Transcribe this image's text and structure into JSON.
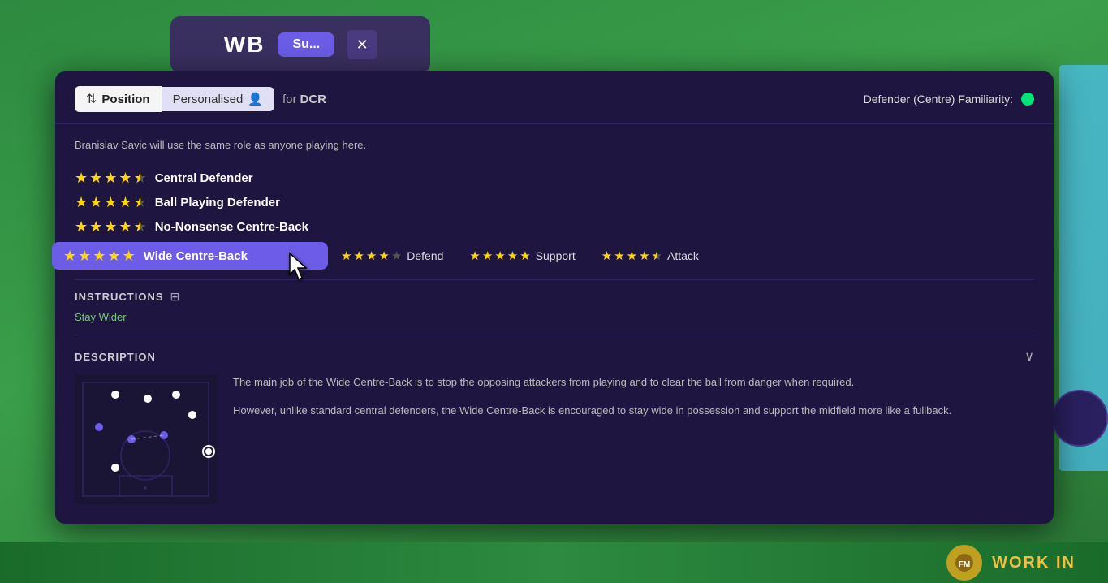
{
  "background": {
    "color": "#2d7a3a"
  },
  "modal": {
    "header": {
      "position_tab_label": "Position",
      "position_icon": "⇅",
      "personalised_label": "Personalised",
      "person_icon": "👤",
      "for_label": "for",
      "dcr_label": "DCR",
      "familiarity_label": "Defender (Centre) Familiarity:",
      "familiarity_color": "#00e676"
    },
    "subtitle": "Branislav Savic will use the same role as anyone playing here.",
    "roles": [
      {
        "name": "Central Defender",
        "stars": 4.5,
        "selected": false
      },
      {
        "name": "Ball Playing Defender",
        "stars": 4.5,
        "selected": false
      },
      {
        "name": "No-Nonsense Centre-Back",
        "stars": 4.5,
        "selected": false
      },
      {
        "name": "Wide Centre-Back",
        "stars": 5,
        "selected": true,
        "duties": [
          {
            "label": "Defend",
            "stars": 4
          },
          {
            "label": "Support",
            "stars": 5
          },
          {
            "label": "Attack",
            "stars": 4.5
          }
        ]
      }
    ],
    "instructions": {
      "title": "INSTRUCTIONS",
      "tags": [
        "Stay Wider"
      ]
    },
    "description": {
      "title": "DESCRIPTION",
      "paragraphs": [
        "The main job of the Wide Centre-Back is to stop the opposing attackers from playing and to clear the ball from danger when required.",
        "However, unlike standard central defenders, the Wide Centre-Back is encouraged to stay wide in possession and support the midfield more like a fullback."
      ]
    }
  },
  "bottom_bar": {
    "work_in_label": "WORK IN"
  },
  "top_card": {
    "text": "WB",
    "button_label": "Su..."
  }
}
